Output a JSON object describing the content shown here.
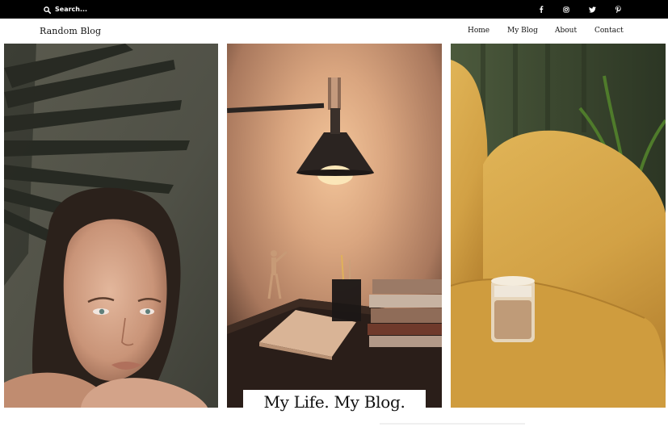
{
  "search": {
    "placeholder": "Search..."
  },
  "social": [
    "facebook-icon",
    "instagram-icon",
    "twitter-icon",
    "pinterest-icon"
  ],
  "site": {
    "title": "Random Blog"
  },
  "nav": {
    "home": "Home",
    "blog": "My Blog",
    "about": "About",
    "contact": "Contact"
  },
  "hero": {
    "caption": "My Life. My Blog."
  },
  "colors": {
    "topbar": "#000000",
    "text": "#111111",
    "panel_left": "#4f5046",
    "panel_middle": "#c9a588",
    "panel_right": "#d2a145"
  }
}
